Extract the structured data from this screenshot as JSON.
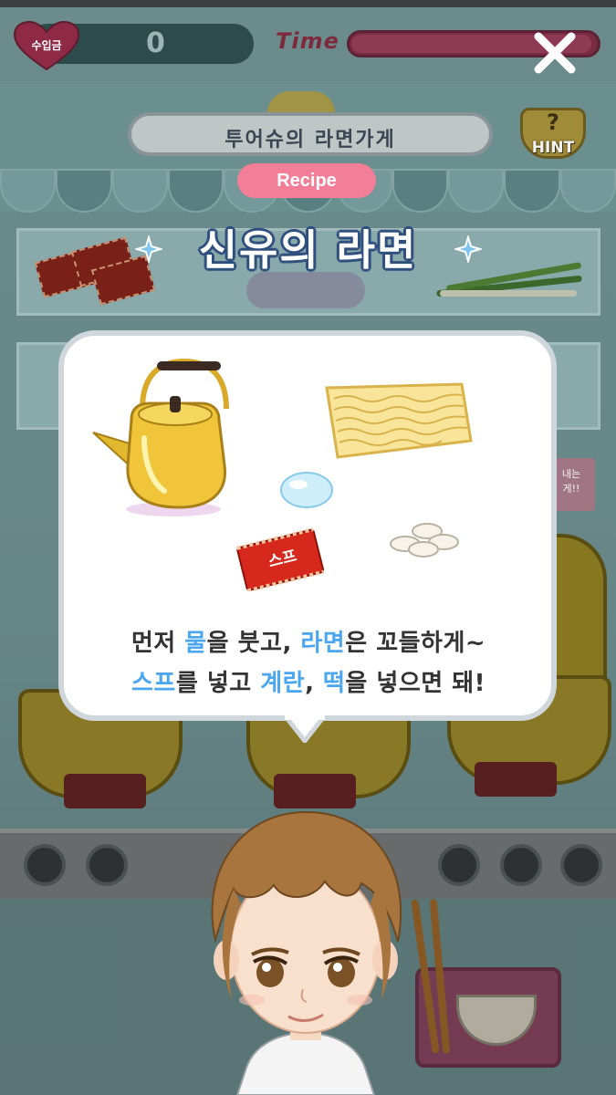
{
  "hud": {
    "money_label": "수입금",
    "money_value": "0",
    "time_label": "Time",
    "time_remaining_fraction": 0.98
  },
  "shop": {
    "sign_text": "투어슈의 라면가게",
    "hint_label": "HINT",
    "hint_symbol": "?"
  },
  "side_note": {
    "line1": "내는",
    "line2": "게!!"
  },
  "recipe": {
    "badge": "Recipe",
    "title": "신유의 라면",
    "packet_label": "스프",
    "line1": {
      "t1": "먼저 ",
      "h1": "물",
      "t2": "을 붓고, ",
      "h2": "라면",
      "t3": "은 꼬들하게~"
    },
    "line2": {
      "h1": "스프",
      "t1": "를 넣고 ",
      "h2": "계란",
      "t2": ", ",
      "h3": "떡",
      "t3": "을 넣으면 돼!"
    }
  },
  "colors": {
    "highlight": "#4aa6ef",
    "badge": "#f37e97",
    "title_outline": "#30507f"
  }
}
